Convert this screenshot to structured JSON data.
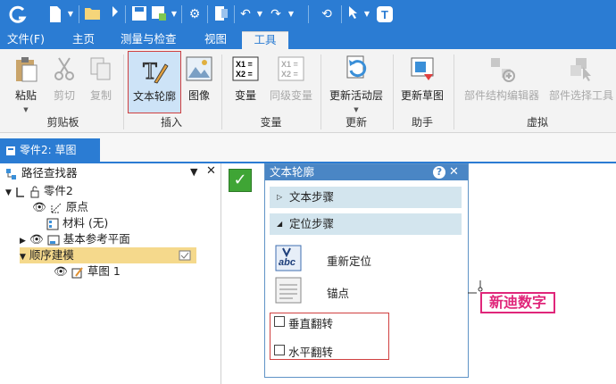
{
  "quick_access": {
    "icons": [
      "app-logo-icon",
      "new-file-icon",
      "open-file-icon",
      "save-icon",
      "settings-icon",
      "undo-icon",
      "redo-icon",
      "select-cursor-icon",
      "help-icon"
    ]
  },
  "menu": {
    "tabs": [
      {
        "label": "文件(F)"
      },
      {
        "label": "主页"
      },
      {
        "label": "测量与检查"
      },
      {
        "label": "视图"
      },
      {
        "label": "工具"
      }
    ],
    "active": "工具"
  },
  "ribbon": {
    "paste": "粘贴",
    "cut": "剪切",
    "copy": "复制",
    "text_outline": "文本轮廓",
    "image": "图像",
    "variable": "变量",
    "same_variable": "同级变量",
    "update_active_layer": "更新活动层",
    "update_sketch": "更新草图",
    "part_structure_editor": "部件结构编辑器",
    "part_select_tool": "部件选择工具",
    "groups": {
      "clipboard": "剪贴板",
      "insert": "插入",
      "variable": "变量",
      "update": "更新",
      "assistant": "助手",
      "virtual": "虚拟"
    }
  },
  "document": {
    "tab_label": "零件2: 草图"
  },
  "finder": {
    "title": "路径查找器",
    "items": [
      {
        "label": "零件2"
      },
      {
        "label": "原点"
      },
      {
        "label": "材料 (无)"
      },
      {
        "label": "基本参考平面"
      },
      {
        "label": "顺序建模"
      },
      {
        "label": "草图 1"
      }
    ]
  },
  "panel": {
    "title": "文本轮廓",
    "text_step": "文本步骤",
    "position_step": "定位步骤",
    "reposition": "重新定位",
    "anchor": "锚点",
    "vertical_flip": "垂直翻转",
    "horizontal_flip": "水平翻转",
    "vertical_flip_checked": false,
    "horizontal_flip_checked": false
  },
  "canvas": {
    "text": "新迪数字"
  },
  "colors": {
    "accent": "#2b7cd3",
    "ribbon_bg": "#f3f3f3",
    "panel_section": "#d3e5ee",
    "highlight_border": "#d04040",
    "sketch_text": "#e0267a",
    "confirm_green": "#3fa535"
  }
}
